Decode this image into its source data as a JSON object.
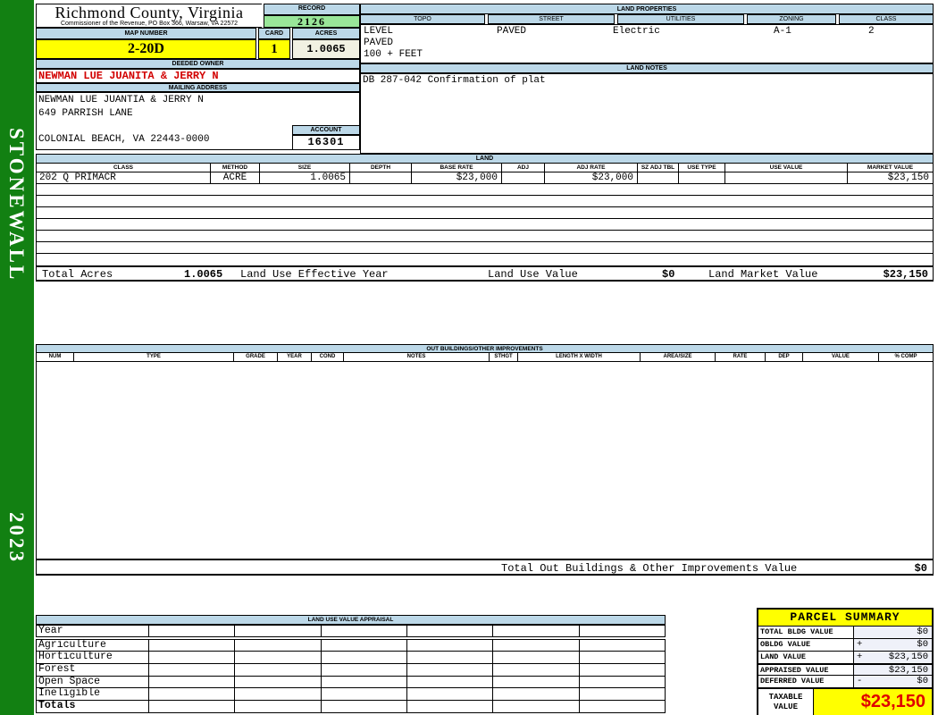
{
  "sidebar": {
    "district": "STONEWALL",
    "year": "2023"
  },
  "header": {
    "county": "Richmond County, Virginia",
    "subtitle": "Commissioner of the Revenue, PO Box 366, Warsaw, VA 22572",
    "record_label": "RECORD",
    "record_value": "2126",
    "map_number_label": "MAP NUMBER",
    "map_number": "2-20D",
    "card_label": "CARD",
    "card": "1",
    "acres_label": "ACRES",
    "acres": "1.0065",
    "deeded_owner_label": "DEEDED OWNER",
    "deeded_owner": "NEWMAN LUE JUANITA & JERRY N",
    "mailing_address_label": "MAILING ADDRESS",
    "mailing_line1": "NEWMAN LUE JUANTIA & JERRY N",
    "mailing_line2": "649 PARRISH LANE",
    "mailing_line3": "",
    "mailing_line4": "COLONIAL BEACH, VA 22443-0000",
    "account_label": "ACCOUNT",
    "account": "16301"
  },
  "land_properties": {
    "title": "LAND PROPERTIES",
    "columns": [
      "TOPO",
      "STREET",
      "UTILITIES",
      "ZONING",
      "CLASS"
    ],
    "topo": "LEVEL",
    "street": "PAVED",
    "utilities": "Electric",
    "zoning": "A-1",
    "class": "2",
    "topo_line2": "PAVED",
    "topo_line3": "100 + FEET"
  },
  "land_notes": {
    "title": "LAND NOTES",
    "note": "DB 287-042 Confirmation of plat"
  },
  "land": {
    "title": "LAND",
    "columns": [
      "CLASS",
      "METHOD",
      "SIZE",
      "DEPTH",
      "BASE RATE",
      "ADJ",
      "ADJ RATE",
      "SZ ADJ TBL",
      "USE TYPE",
      "USE VALUE",
      "MARKET VALUE"
    ],
    "rows": [
      {
        "class": "202 Q PRIMACR",
        "method": "ACRE",
        "size": "1.0065",
        "depth": "",
        "base_rate": "$23,000",
        "adj": "",
        "adj_rate": "$23,000",
        "sz_adj_tbl": "",
        "use_type": "",
        "use_value": "",
        "market_value": "$23,150"
      }
    ],
    "totals": {
      "total_acres_label": "Total Acres",
      "total_acres": "1.0065",
      "effective_year_label": "Land Use Effective Year",
      "use_value_label": "Land Use Value",
      "use_value": "$0",
      "market_value_label": "Land Market Value",
      "market_value": "$23,150"
    }
  },
  "out_buildings": {
    "title": "OUT BUILDINGS/OTHER IMPROVEMENTS",
    "columns": [
      "NUM",
      "TYPE",
      "GRADE",
      "YEAR",
      "COND",
      "NOTES",
      "STHGT",
      "LENGTH X WIDTH",
      "AREA/SIZE",
      "RATE",
      "DEP",
      "VALUE",
      "% COMP"
    ],
    "total_label": "Total Out Buildings & Other Improvements Value",
    "total_value": "$0"
  },
  "land_use_appraisal": {
    "title": "LAND USE VALUE APPRAISAL",
    "rows": [
      "Year",
      "Agriculture",
      "Horticulture",
      "Forest",
      "Open Space",
      "Ineligible",
      "Totals"
    ]
  },
  "parcel_summary": {
    "title": "PARCEL SUMMARY",
    "rows": [
      {
        "label": "TOTAL BLDG VALUE",
        "op": "",
        "value": "$0"
      },
      {
        "label": "OBLDG VALUE",
        "op": "+",
        "value": "$0"
      },
      {
        "label": "LAND VALUE",
        "op": "+",
        "value": "$23,150"
      },
      {
        "label": "APPRAISED VALUE",
        "op": "",
        "value": "$23,150"
      },
      {
        "label": "DEFERRED VALUE",
        "op": "-",
        "value": "$0"
      }
    ],
    "taxable_label_line1": "TAXABLE",
    "taxable_label_line2": "VALUE",
    "taxable_value": "$23,150"
  },
  "colors": {
    "header_bar_blue": "#BCD8E8",
    "record_green": "#99E699",
    "highlight_yellow": "#FFFF00",
    "acres_cream": "#F1F1E2",
    "sidebar_green": "#128012",
    "owner_red": "#D20000",
    "taxable_red": "#E00000"
  }
}
